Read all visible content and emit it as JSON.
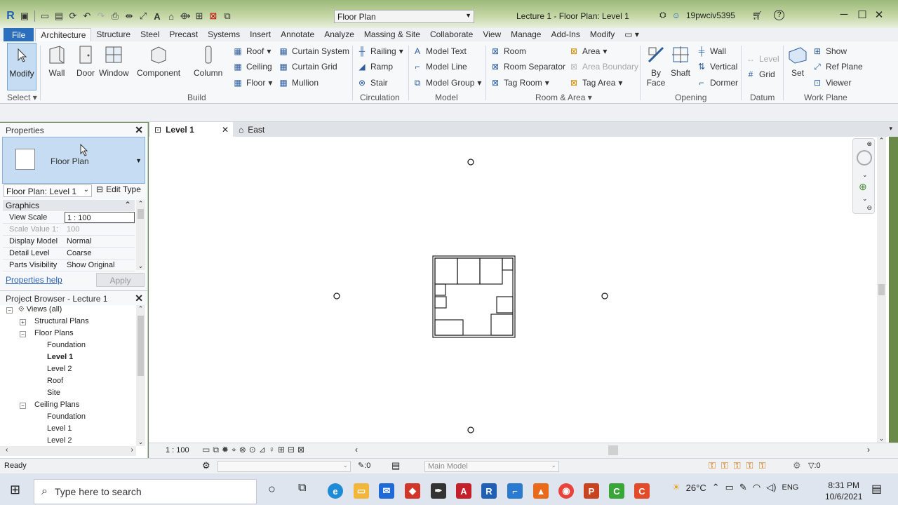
{
  "titlebar": {
    "view_combo": "Floor Plan",
    "window_title": "Lecture 1 - Floor Plan: Level 1",
    "username": "19pwciv5395",
    "help": "?"
  },
  "menu": {
    "file": "File",
    "tabs": [
      "Architecture",
      "Structure",
      "Steel",
      "Precast",
      "Systems",
      "Insert",
      "Annotate",
      "Analyze",
      "Massing & Site",
      "Collaborate",
      "View",
      "Manage",
      "Add-Ins",
      "Modify"
    ]
  },
  "ribbon": {
    "select": "Select",
    "modify": "Modify",
    "build": {
      "label": "Build",
      "wall": "Wall",
      "door": "Door",
      "window": "Window",
      "component": "Component",
      "column": "Column",
      "roof": "Roof",
      "ceiling": "Ceiling",
      "floor": "Floor",
      "curtain_system": "Curtain System",
      "curtain_grid": "Curtain Grid",
      "mullion": "Mullion"
    },
    "circulation": {
      "label": "Circulation",
      "railing": "Railing",
      "ramp": "Ramp",
      "stair": "Stair"
    },
    "model": {
      "label": "Model",
      "text": "Model Text",
      "line": "Model Line",
      "group": "Model Group"
    },
    "room_area": {
      "label": "Room & Area",
      "room": "Room",
      "separator": "Room Separator",
      "tag_room": "Tag Room",
      "area": "Area",
      "area_boundary": "Area Boundary",
      "tag_area": "Tag Area"
    },
    "opening": {
      "label": "Opening",
      "by_face_1": "By",
      "by_face_2": "Face",
      "shaft": "Shaft",
      "wall": "Wall",
      "vertical": "Vertical",
      "dormer": "Dormer"
    },
    "datum": {
      "label": "Datum",
      "level": "Level",
      "grid": "Grid"
    },
    "workplane": {
      "label": "Work Plane",
      "set": "Set",
      "show": "Show",
      "ref_plane": "Ref Plane",
      "viewer": "Viewer"
    }
  },
  "properties": {
    "title": "Properties",
    "type_name": "Floor Plan",
    "instance": "Floor Plan: Level 1",
    "edit_type": "Edit Type",
    "group": "Graphics",
    "rows": [
      {
        "key": "View Scale",
        "value": "1 : 100"
      },
      {
        "key": "Scale Value    1:",
        "value": "100"
      },
      {
        "key": "Display Model",
        "value": "Normal"
      },
      {
        "key": "Detail Level",
        "value": "Coarse"
      },
      {
        "key": "Parts Visibility",
        "value": "Show Original"
      }
    ],
    "help": "Properties help",
    "apply": "Apply"
  },
  "browser": {
    "title": "Project Browser - Lecture 1",
    "nodes": [
      "Views (all)",
      "Structural Plans",
      "Floor Plans",
      "Foundation",
      "Level 1",
      "Level 2",
      "Roof",
      "Site",
      "Ceiling Plans",
      "Foundation",
      "Level 1",
      "Level 2"
    ]
  },
  "viewtabs": {
    "active": "Level 1",
    "other": "East"
  },
  "viewbar": {
    "scale": "1 : 100"
  },
  "status": {
    "ready": "Ready",
    "zero": ":0",
    "workset": "Main Model",
    "filter": ":0"
  },
  "taskbar": {
    "search": "Type here to search",
    "temp": "26°C",
    "lang": "ENG",
    "time": "8:31 PM",
    "date": "10/6/2021",
    "apps": [
      "edge",
      "explorer",
      "mail",
      "sketchup",
      "inkscape",
      "acrobat",
      "revit",
      "autocad",
      "matlab",
      "chrome",
      "powerpoint",
      "camtasia",
      "snagit"
    ]
  },
  "colors": {
    "accent": "#2a6ebd",
    "selection": "#c5dcf2"
  }
}
